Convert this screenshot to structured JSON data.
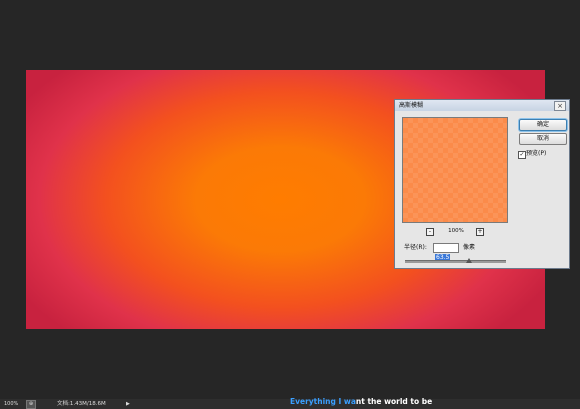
{
  "dialog": {
    "title": "高斯模糊",
    "close_glyph": "×",
    "ok_label": "确定",
    "cancel_label": "取消",
    "preview_label": "预览(P)",
    "preview_checked": true,
    "preview_check_glyph": "✓",
    "zoom_out_glyph": "-",
    "zoom_in_glyph": "+",
    "zoom": "100%",
    "radius_label": "半径(R):",
    "radius_value": "63.5",
    "radius_unit": "像素"
  },
  "status": {
    "zoom": "100%",
    "nav_glyph": "⊕",
    "doc_info": "文档:1.43M/18.6M",
    "arrow_glyph": "▶"
  },
  "subtitle": {
    "highlighted": "Everything I wa",
    "rest": "nt the world to be"
  },
  "colors": {
    "workspace": "#262626",
    "canvas_center": "#ff7c00",
    "canvas_edge": "#c8223f",
    "subtitle_highlight": "#3a9fff"
  }
}
